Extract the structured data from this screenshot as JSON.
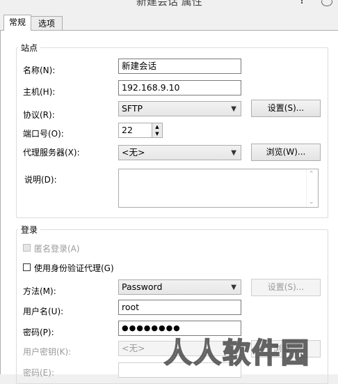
{
  "window": {
    "title": "新建会话 属性",
    "help_glyph": "?"
  },
  "tabs": [
    {
      "label": "常规",
      "active": true
    },
    {
      "label": "选项",
      "active": false
    }
  ],
  "site": {
    "group_title": "站点",
    "name_label": "名称(N):",
    "name_value": "新建会话",
    "host_label": "主机(H):",
    "host_value": "192.168.9.10",
    "protocol_label": "协议(R):",
    "protocol_value": "SFTP",
    "settings_button": "设置(S)...",
    "port_label": "端口号(O):",
    "port_value": "22",
    "proxy_label": "代理服务器(X):",
    "proxy_value": "<无>",
    "browse_button": "浏览(W)...",
    "desc_label": "说明(D):"
  },
  "login": {
    "group_title": "登录",
    "anonymous_label": "匿名登录(A)",
    "agent_label": "使用身份验证代理(G)",
    "method_label": "方法(M):",
    "method_value": "Password",
    "method_settings_button": "设置(S)...",
    "username_label": "用户名(U):",
    "username_value": "root",
    "password_label": "密码(P):",
    "password_value": "●●●●●●●●",
    "userkey_label": "用户密钥(K):",
    "userkey_value": "<无>",
    "userkey_browse_button": "浏览...",
    "passphrase_label": "密码(E):"
  },
  "watermark": "人人软件园",
  "colors": {
    "panel_bg": "#ffffff",
    "window_bg": "#f0f0f0",
    "disabled_text": "#9a9a9a"
  }
}
